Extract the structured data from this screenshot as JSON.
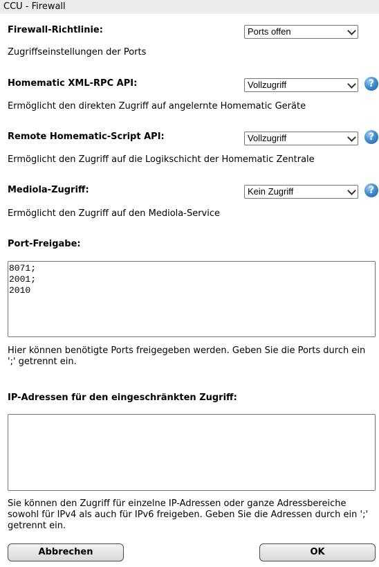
{
  "window": {
    "title": "CCU - Firewall"
  },
  "policy": {
    "label": "Firewall-Richtlinie:",
    "value": "Ports offen",
    "description": "Zugriffseinstellungen der Ports"
  },
  "xmlrpc": {
    "label": "Homematic XML-RPC API:",
    "value": "Vollzugriff",
    "description": "Ermöglicht den direkten Zugriff auf angelernte Homematic Geräte",
    "help": "?"
  },
  "script": {
    "label": "Remote Homematic-Script API:",
    "value": "Vollzugriff",
    "description": "Ermöglicht den Zugriff auf die Logikschicht der Homematic Zentrale",
    "help": "?"
  },
  "mediola": {
    "label": "Mediola-Zugriff:",
    "value": "Kein Zugriff",
    "description": "Ermöglicht den Zugriff auf den Mediola-Service",
    "help": "?"
  },
  "ports": {
    "label": "Port-Freigabe:",
    "value": "8071;\n2001;\n2010",
    "hint": "Hier können benötigte Ports freigegeben werden. Geben Sie die Ports durch ein ';' getrennt ein."
  },
  "ip": {
    "label": "IP-Adressen für den eingeschränkten Zugriff:",
    "value": "",
    "hint": "Sie können den Zugriff für einzelne IP-Adressen oder ganze Adressbereiche sowohl für IPv4 als auch für IPv6 freigeben. Geben Sie die Adressen durch ein ';' getrennt ein."
  },
  "buttons": {
    "cancel": "Abbrechen",
    "ok": "OK"
  }
}
